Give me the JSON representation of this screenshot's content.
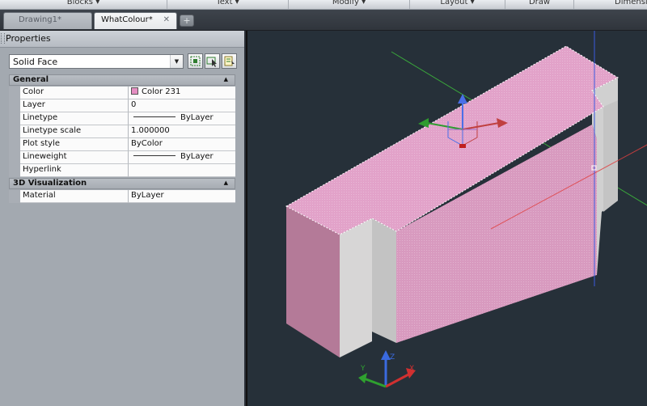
{
  "ribbon": {
    "panels": [
      {
        "label": "Blocks ▾"
      },
      {
        "label": "Text ▾"
      },
      {
        "label": "Modify ▾"
      },
      {
        "label": "Layout ▾"
      },
      {
        "label": "Draw"
      },
      {
        "label": "Dimensio"
      }
    ]
  },
  "tabs": [
    {
      "label": "Drawing1*",
      "active": false
    },
    {
      "label": "WhatColour*",
      "active": true
    }
  ],
  "tab_close_glyph": "✕",
  "new_tab_glyph": "+",
  "properties": {
    "title": "Properties",
    "selection": "Solid Face",
    "sections": [
      {
        "label": "General",
        "rows": [
          {
            "name": "Color",
            "value": "Color 231",
            "swatch": "#e48ec2"
          },
          {
            "name": "Layer",
            "value": "0"
          },
          {
            "name": "Linetype",
            "value": "ByLayer",
            "line": true
          },
          {
            "name": "Linetype scale",
            "value": "1.000000"
          },
          {
            "name": "Plot style",
            "value": "ByColor"
          },
          {
            "name": "Lineweight",
            "value": "ByLayer",
            "line": true
          },
          {
            "name": "Hyperlink",
            "value": ""
          }
        ]
      },
      {
        "label": "3D Visualization",
        "rows": [
          {
            "name": "Material",
            "value": "ByLayer"
          }
        ]
      }
    ]
  },
  "colors": {
    "viewport_bg": "#263039",
    "face_pink": "#dc9ec3",
    "face_pink_dark": "#b07a97",
    "face_grey": "#c9c9c9"
  },
  "icons": {
    "quick_select": "quick-select-icon",
    "select_objects": "select-objects-icon",
    "toggle_pickadd": "toggle-pickadd-icon"
  }
}
